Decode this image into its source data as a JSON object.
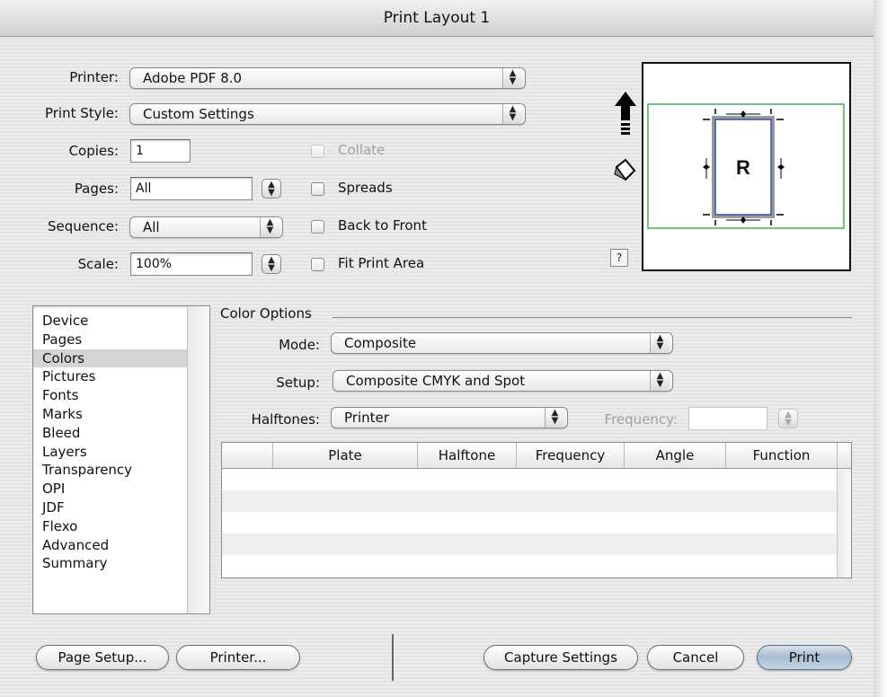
{
  "window": {
    "title": "Print Layout 1"
  },
  "form": {
    "printer_label": "Printer:",
    "printer_value": "Adobe PDF 8.0",
    "print_style_label": "Print Style:",
    "print_style_value": "Custom Settings",
    "copies_label": "Copies:",
    "copies_value": "1",
    "pages_label": "Pages:",
    "pages_value": "All",
    "sequence_label": "Sequence:",
    "sequence_value": "All",
    "scale_label": "Scale:",
    "scale_value": "100%"
  },
  "checkboxes": {
    "collate": "Collate",
    "spreads": "Spreads",
    "back_to_front": "Back to Front",
    "fit_print_area": "Fit Print Area"
  },
  "preview": {
    "page_letter": "R",
    "help_label": "?"
  },
  "sidebar": {
    "items": [
      "Device",
      "Pages",
      "Colors",
      "Pictures",
      "Fonts",
      "Marks",
      "Bleed",
      "Layers",
      "Transparency",
      "OPI",
      "JDF",
      "Flexo",
      "Advanced",
      "Summary"
    ],
    "selected": "Colors"
  },
  "color_options": {
    "group_title": "Color Options",
    "mode_label": "Mode:",
    "mode_value": "Composite",
    "setup_label": "Setup:",
    "setup_value": "Composite CMYK and Spot",
    "halftones_label": "Halftones:",
    "halftones_value": "Printer",
    "frequency_label": "Frequency:",
    "frequency_value": ""
  },
  "table": {
    "columns": [
      "Plate",
      "Halftone",
      "Frequency",
      "Angle",
      "Function"
    ],
    "rows": []
  },
  "buttons": {
    "page_setup": "Page Setup...",
    "printer": "Printer...",
    "capture_settings": "Capture Settings",
    "cancel": "Cancel",
    "print": "Print"
  },
  "colors": {
    "preview_printable_border": "#4caf50",
    "preview_page_border": "#3b4fa8",
    "default_button": "#a9bdd3"
  },
  "icons": {
    "orientation": "up-arrow-icon",
    "rotate": "rotate-page-icon"
  }
}
